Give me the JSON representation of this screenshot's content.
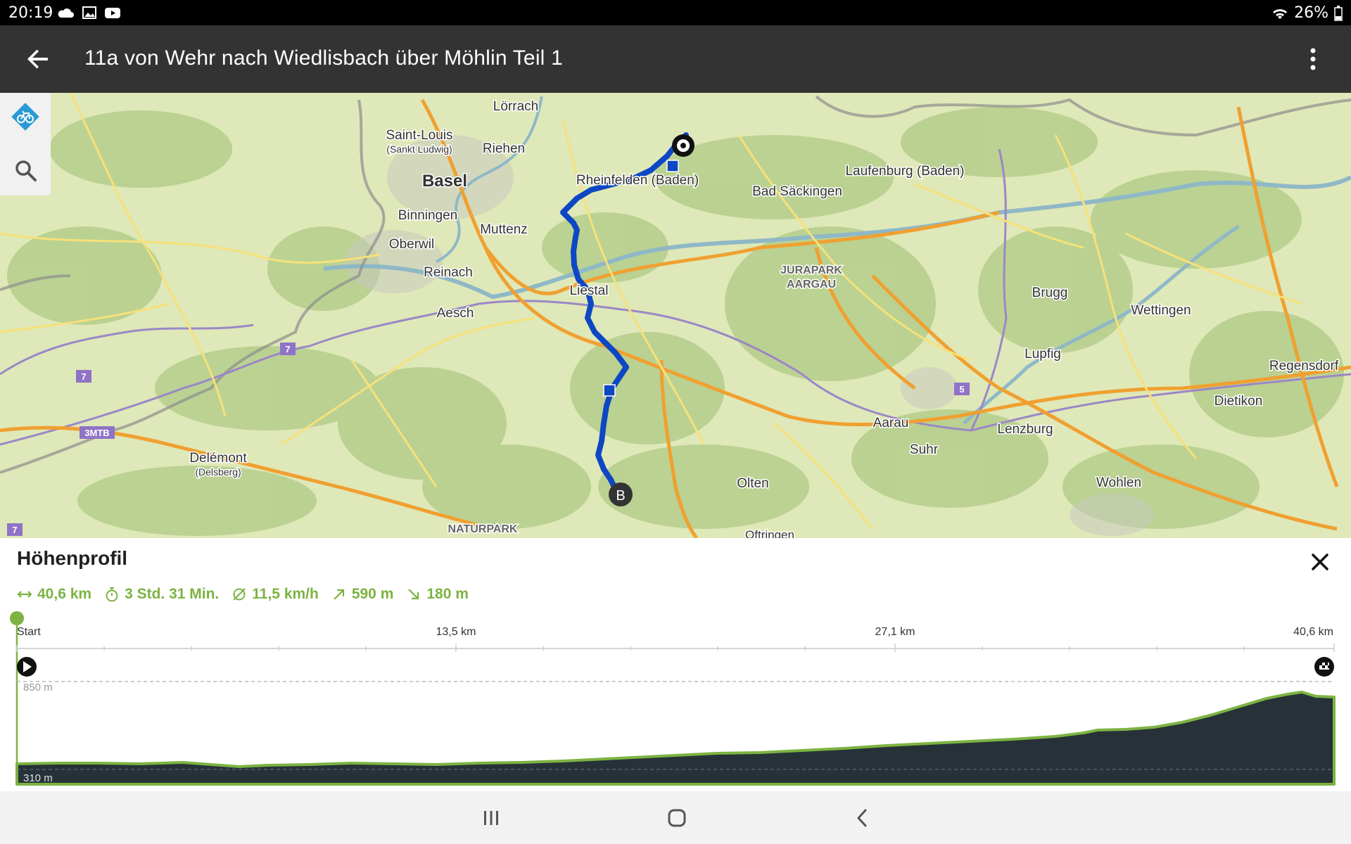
{
  "status_bar": {
    "time": "20:19",
    "battery": "26%"
  },
  "app_bar": {
    "title": "11a von Wehr nach Wiedlisbach über Möhlin Teil 1"
  },
  "map": {
    "labels": [
      "Lörrach",
      "Saint-Louis",
      "(Sankt Ludwig)",
      "Riehen",
      "Basel",
      "Rheinfelden (Baden)",
      "Laufenburg (Baden)",
      "Bad Säckingen",
      "Binningen",
      "Muttenz",
      "Oberwil",
      "Reinach",
      "Liestal",
      "Aesch",
      "JURAPARK",
      "AARGAU",
      "Brugg",
      "Wettingen",
      "Lupfig",
      "Regensdorf",
      "Dietikon",
      "Aarau",
      "Lenzburg",
      "Suhr",
      "Delémont",
      "(Delsberg)",
      "Olten",
      "Wohlen",
      "NATURPARK",
      "Oftringen"
    ],
    "route_badges": [
      "7",
      "7",
      "3MTB",
      "5",
      "7"
    ],
    "end_marker": "B"
  },
  "profile": {
    "title": "Höhenprofil",
    "stats": {
      "distance": "40,6 km",
      "duration": "3 Std. 31 Min.",
      "speed": "11,5 km/h",
      "ascent": "590 m",
      "descent": "180 m"
    },
    "axis": {
      "start": "Start",
      "mid1": "13,5 km",
      "mid2": "27,1 km",
      "end": "40,6 km"
    },
    "max_label": "850 m",
    "min_label": "310 m",
    "colors": {
      "accent": "#7cb342",
      "fill": "#263238",
      "route": "#0d47c4"
    }
  }
}
